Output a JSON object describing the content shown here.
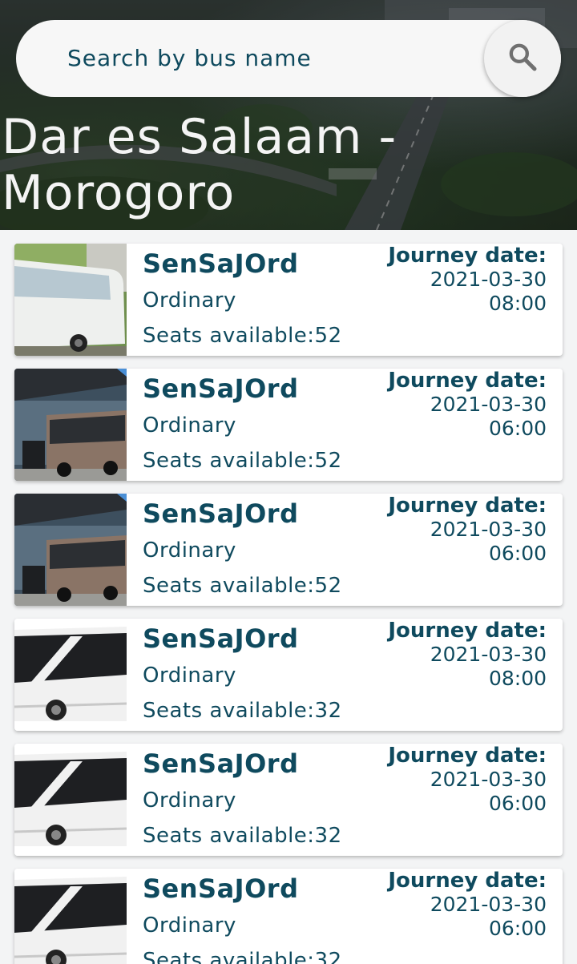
{
  "search": {
    "placeholder": "Search by bus name",
    "icon": "search-icon"
  },
  "route": {
    "title": "Dar es Salaam - Morogoro"
  },
  "colors": {
    "text_primary": "#0f4a5e",
    "card_bg": "#ffffff",
    "title_text": "#f4f4f4"
  },
  "buses": [
    {
      "name": "SenSaJOrd",
      "class": "Ordinary",
      "seats": "Seats available:52",
      "journey_label": "Journey date:",
      "date": "2021-03-30",
      "time": "08:00",
      "image": "white-coach-trees"
    },
    {
      "name": "SenSaJOrd",
      "class": "Ordinary",
      "seats": "Seats available:52",
      "journey_label": "Journey date:",
      "date": "2021-03-30",
      "time": "06:00",
      "image": "bronze-bus-station"
    },
    {
      "name": "SenSaJOrd",
      "class": "Ordinary",
      "seats": "Seats available:52",
      "journey_label": "Journey date:",
      "date": "2021-03-30",
      "time": "06:00",
      "image": "bronze-bus-station"
    },
    {
      "name": "SenSaJOrd",
      "class": "Ordinary",
      "seats": "Seats available:32",
      "journey_label": "Journey date:",
      "date": "2021-03-30",
      "time": "08:00",
      "image": "white-coach-side"
    },
    {
      "name": "SenSaJOrd",
      "class": "Ordinary",
      "seats": "Seats available:32",
      "journey_label": "Journey date:",
      "date": "2021-03-30",
      "time": "06:00",
      "image": "white-coach-side"
    },
    {
      "name": "SenSaJOrd",
      "class": "Ordinary",
      "seats": "Seats available:32",
      "journey_label": "Journey date:",
      "date": "2021-03-30",
      "time": "06:00",
      "image": "white-coach-side"
    }
  ]
}
